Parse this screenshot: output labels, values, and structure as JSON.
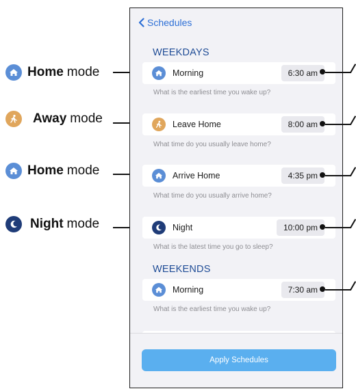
{
  "annotations": [
    {
      "bold": "Home",
      "rest": "mode",
      "icon": "home-icon",
      "color": "#5b8ed6"
    },
    {
      "bold": "Away",
      "rest": "mode",
      "icon": "walking-person-icon",
      "color": "#e0a65c"
    },
    {
      "bold": "Home",
      "rest": "mode",
      "icon": "home-icon",
      "color": "#5b8ed6"
    },
    {
      "bold": "Night",
      "rest": "mode",
      "icon": "moon-icon",
      "color": "#1f3c78"
    }
  ],
  "nav": {
    "back_label": "Schedules"
  },
  "weekdays": {
    "title": "WEEKDAYS",
    "items": [
      {
        "label": "Morning",
        "time": "6:30 am",
        "hint": "What is the earliest time you wake up?",
        "icon": "home-icon"
      },
      {
        "label": "Leave Home",
        "time": "8:00 am",
        "hint": "What time do you usually leave home?",
        "icon": "walking-person-icon"
      },
      {
        "label": "Arrive Home",
        "time": "4:35 pm",
        "hint": "What time do you usually arrive home?",
        "icon": "home-icon"
      },
      {
        "label": "Night",
        "time": "10:00 pm",
        "hint": "What is the latest time you go to sleep?",
        "icon": "moon-icon"
      }
    ]
  },
  "weekends": {
    "title": "WEEKENDS",
    "items": [
      {
        "label": "Morning",
        "time": "7:30 am",
        "hint": "What is the earliest time you wake up?",
        "icon": "home-icon"
      }
    ]
  },
  "apply_button": "Apply Schedules",
  "colors": {
    "accent": "#2c6fd6",
    "section": "#1f4c96",
    "home": "#5b8ed6",
    "away": "#e0a65c",
    "night": "#1f3c78",
    "apply": "#5aafef"
  }
}
